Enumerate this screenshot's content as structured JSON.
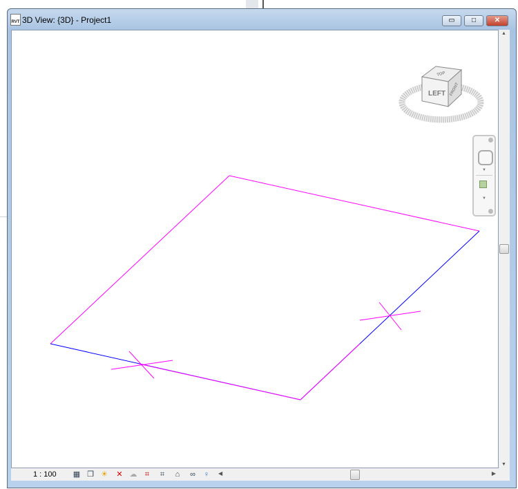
{
  "window": {
    "title": "3D View: {3D} - Project1",
    "app_icon": "RVT",
    "minimize": "▭",
    "maximize": "□",
    "close": "✕"
  },
  "viewcube": {
    "face_front": "LEFT",
    "face_right": "FRONT",
    "face_top": "TOP"
  },
  "status": {
    "scale": "1 : 100"
  },
  "toolbar_icons": [
    "detail-level-icon",
    "visual-style-icon",
    "sun-path-icon",
    "shadows-icon",
    "rendering-icon",
    "crop-view-icon",
    "show-crop-icon",
    "lock-view-icon",
    "temporary-hide-icon",
    "reveal-hidden-icon"
  ],
  "colors": {
    "plane": "#ff00ff",
    "edge": "#0000ff"
  }
}
